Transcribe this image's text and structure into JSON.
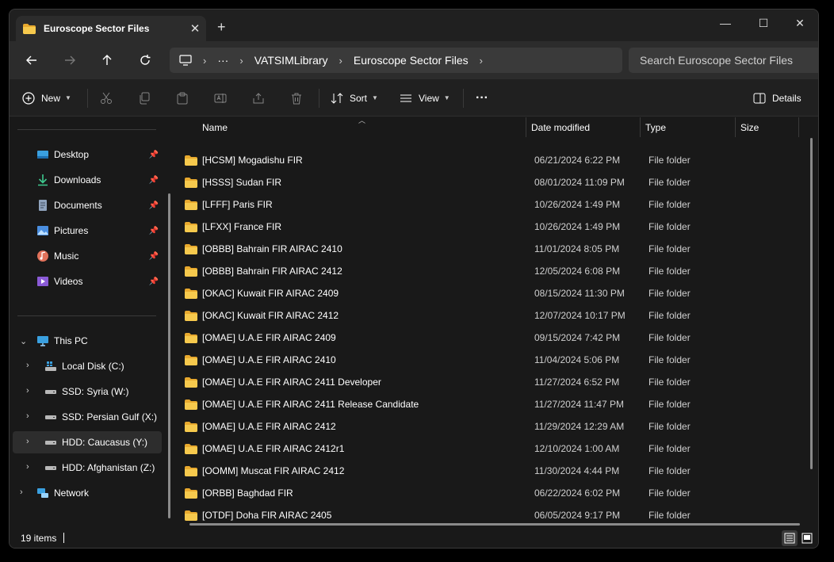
{
  "window": {
    "tab_title": "Euroscope Sector Files",
    "tab_close": "✕",
    "new_tab": "+",
    "minimize": "—",
    "maximize": "☐",
    "close": "✕"
  },
  "address": {
    "overflow": "···",
    "crumbs": [
      "VATSIMLibrary",
      "Euroscope Sector Files"
    ],
    "search_placeholder": "Search Euroscope Sector Files"
  },
  "toolbar": {
    "new_label": "New",
    "sort_label": "Sort",
    "view_label": "View",
    "more_label": "···",
    "details_label": "Details"
  },
  "sidebar": {
    "quick_access": [
      {
        "label": "Desktop"
      },
      {
        "label": "Downloads"
      },
      {
        "label": "Documents"
      },
      {
        "label": "Pictures"
      },
      {
        "label": "Music"
      },
      {
        "label": "Videos"
      }
    ],
    "this_pc": "This PC",
    "drives": [
      {
        "label": "Local Disk (C:)"
      },
      {
        "label": "SSD: Syria (W:)"
      },
      {
        "label": "SSD: Persian Gulf (X:)"
      },
      {
        "label": "HDD: Caucasus (Y:)"
      },
      {
        "label": "HDD: Afghanistan (Z:)"
      }
    ],
    "network": "Network"
  },
  "columns": {
    "name": "Name",
    "date": "Date modified",
    "type": "Type",
    "size": "Size"
  },
  "files": [
    {
      "name": "[HCSM] Mogadishu FIR",
      "date": "06/21/2024 6:22 PM",
      "type": "File folder"
    },
    {
      "name": "[HSSS] Sudan FIR",
      "date": "08/01/2024 11:09 PM",
      "type": "File folder"
    },
    {
      "name": "[LFFF] Paris FIR",
      "date": "10/26/2024 1:49 PM",
      "type": "File folder"
    },
    {
      "name": "[LFXX] France FIR",
      "date": "10/26/2024 1:49 PM",
      "type": "File folder"
    },
    {
      "name": "[OBBB] Bahrain FIR AIRAC 2410",
      "date": "11/01/2024 8:05 PM",
      "type": "File folder"
    },
    {
      "name": "[OBBB] Bahrain FIR AIRAC 2412",
      "date": "12/05/2024 6:08 PM",
      "type": "File folder"
    },
    {
      "name": "[OKAC] Kuwait FIR AIRAC 2409",
      "date": "08/15/2024 11:30 PM",
      "type": "File folder"
    },
    {
      "name": "[OKAC] Kuwait FIR AIRAC 2412",
      "date": "12/07/2024 10:17 PM",
      "type": "File folder"
    },
    {
      "name": "[OMAE] U.A.E FIR AIRAC 2409",
      "date": "09/15/2024 7:42 PM",
      "type": "File folder"
    },
    {
      "name": "[OMAE] U.A.E FIR AIRAC 2410",
      "date": "11/04/2024 5:06 PM",
      "type": "File folder"
    },
    {
      "name": "[OMAE] U.A.E FIR AIRAC 2411 Developer",
      "date": "11/27/2024 6:52 PM",
      "type": "File folder"
    },
    {
      "name": "[OMAE] U.A.E FIR AIRAC 2411 Release Candidate",
      "date": "11/27/2024 11:47 PM",
      "type": "File folder"
    },
    {
      "name": "[OMAE] U.A.E FIR AIRAC 2412",
      "date": "11/29/2024 12:29 AM",
      "type": "File folder"
    },
    {
      "name": "[OMAE] U.A.E FIR AIRAC 2412r1",
      "date": "12/10/2024 1:00 AM",
      "type": "File folder"
    },
    {
      "name": "[OOMM] Muscat FIR AIRAC 2412",
      "date": "11/30/2024 4:44 PM",
      "type": "File folder"
    },
    {
      "name": "[ORBB] Baghdad FIR",
      "date": "06/22/2024 6:02 PM",
      "type": "File folder"
    },
    {
      "name": "[OTDF] Doha FIR AIRAC 2405",
      "date": "06/05/2024 9:17 PM",
      "type": "File folder"
    }
  ],
  "status": {
    "item_count": "19 items"
  },
  "colors": {
    "folder": "#f2c04a",
    "window_bg": "#191919",
    "accent": "#4cc2ff"
  }
}
